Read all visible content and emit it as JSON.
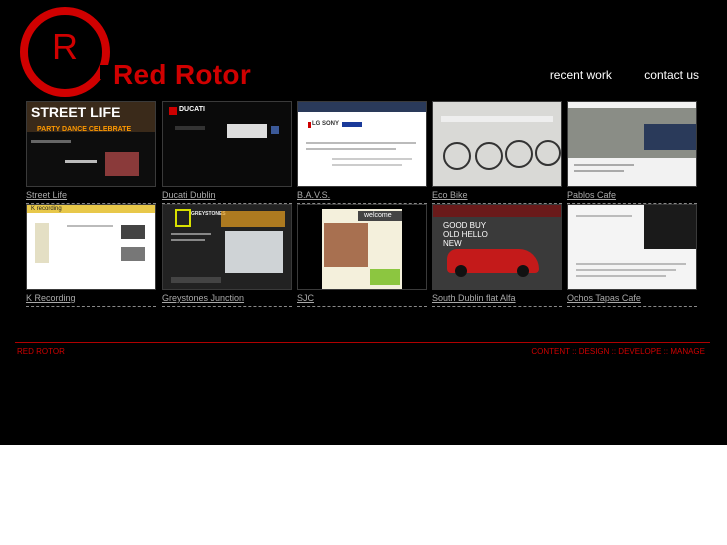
{
  "brand": {
    "logo_letter": "R",
    "name": "Red Rotor"
  },
  "nav": {
    "recent_work": "recent work",
    "contact_us": "contact us"
  },
  "projects": [
    {
      "caption": "Street Life",
      "thumb_title": "STREET LIFE",
      "thumb_sub": "PARTY DANCE CELEBRATE"
    },
    {
      "caption": "Ducati Dublin",
      "thumb_title": "DUCATI"
    },
    {
      "caption": "B.A.V.S.",
      "thumb_title": "LG SONY"
    },
    {
      "caption": "Eco Bike"
    },
    {
      "caption": "Pablos Cafe"
    },
    {
      "caption": "K Recording",
      "thumb_title": "K recording"
    },
    {
      "caption": "Greystones Junction",
      "thumb_title": "GREYSTONES"
    },
    {
      "caption": "SJC",
      "thumb_title": "welcome"
    },
    {
      "caption": "South Dublin flat Alfa",
      "thumb_title": "GOOD BUY OLD HELLO NEW"
    },
    {
      "caption": "Ochos Tapas Cafe"
    }
  ],
  "footer": {
    "left": "RED ROTOR",
    "right": "CONTENT :: DESIGN :: DEVELOPE :: MANAGE"
  },
  "colors": {
    "brand_red": "#d00000",
    "background": "#000000"
  }
}
